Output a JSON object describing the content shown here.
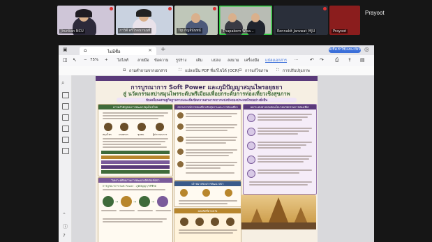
{
  "participants": [
    {
      "name": "Jirunkan NCU"
    },
    {
      "name": "ภาวิดี ตรีโรจนานนท์"
    },
    {
      "name": "Tip กัญจ์นันทน์"
    },
    {
      "name": "Thapakorn Wisa..."
    },
    {
      "name": "Ronnakit Jaruwat_MJU"
    },
    {
      "name": "Prayoot"
    }
  ],
  "speaker": "Prayoot",
  "browser": {
    "tab_title": "ไม่มีชื่อ",
    "tab_close": "×",
    "new_tab": "+",
    "account_pill": "ลงชื่อเข้าใช้/ลงทะเบียน"
  },
  "toolbar": {
    "zoom": "75%",
    "minus": "−",
    "plus": "+",
    "items": [
      "ไฮไลท์",
      "ลายมือ",
      "ข้อความ",
      "รูปร่าง",
      "เติม",
      "แปลง",
      "ลงนาม",
      "เครื่องมือ",
      "แชร์"
    ],
    "active_item": "แปลงเอกสาร",
    "more": "···"
  },
  "subtoolbar": {
    "items": [
      "ถามคำถามจากเอกสาร",
      "แปลงเป็น PDF ที่แก้ไขได้ (OCR)",
      "การแก้ไขภาพ",
      "การปรับปรุงภาพ"
    ]
  },
  "poster": {
    "title_line1": "การบูรณาการ Soft Power และภูมิปัญญาสมุนไพรอยุธยา",
    "title_line2": "สู่ นวัตกรรมสปาสมุนไพรระดับพรีเมียมเพื่อยกระดับการท่องเที่ยวเชิงสุขภาพ",
    "subtitle": "ขับเคลื่อนเศรษฐกิจฐานรากและเพิ่มขีดความสามารถการแข่งขันของประเทศไทยอย่างยั่งยืน",
    "panel_left_title": "ความสำคัญของการพัฒนาสมุนไพรไทย",
    "panel_mid_title": "สถานการณ์การท่องเที่ยวเชิงสุขภาพและการท่องเที่ยว",
    "panel_right_title": "ผลกระทบทางตรงต่อนโยบายนวัตกรรมการท่องเที่ยว",
    "panel_left2_title": "วิเคราะห์ศักยภาพการพัฒนาผลิตภัณฑ์สปา",
    "panel_mid2_title": "เป้าหมายของการพัฒนาสปา",
    "panel_bottom_title": "ผลผลิตที่คาดหวัง",
    "soft_power_row": "การบูรณาการ Soft Power : ภูมิปัญญา/วิถีชีวิต",
    "icon_labels": [
      "สมุนไพร",
      "เกษตรกร",
      "ชุมชน",
      "ผู้ประกอบการ"
    ]
  },
  "colors": {
    "poster_purple": "#5a3a7a",
    "poster_green": "#3f6b3a",
    "poster_gold": "#b8862c",
    "accent_blue": "#3b6fd9",
    "active_speaker": "#2ecc40"
  }
}
